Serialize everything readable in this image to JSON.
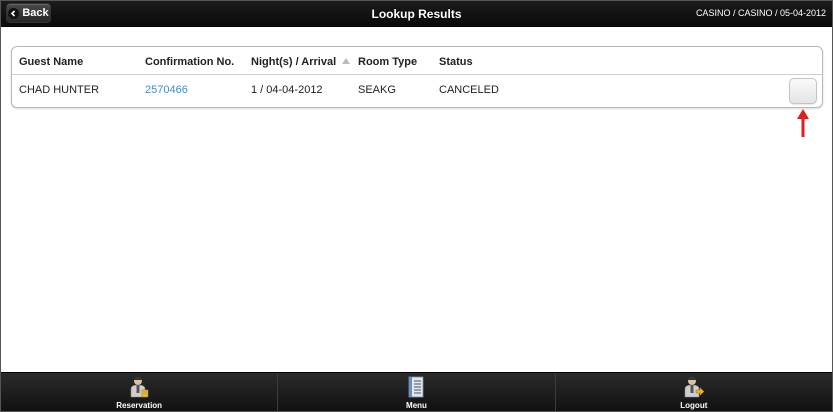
{
  "header": {
    "back_label": "Back",
    "title": "Lookup Results",
    "context": "CASINO / CASINO / 05-04-2012"
  },
  "table": {
    "columns": [
      "Guest Name",
      "Confirmation No.",
      "Night(s) / Arrival",
      "Room Type",
      "Status"
    ],
    "rows": [
      {
        "guest_name": "CHAD HUNTER",
        "confirmation_no": "2570466",
        "nights_arrival": "1 / 04-04-2012",
        "room_type": "SEAKG",
        "status": "CANCELED"
      }
    ]
  },
  "footer": {
    "items": [
      {
        "label": "Reservation",
        "icon": "reservation-icon"
      },
      {
        "label": "Menu",
        "icon": "menu-icon"
      },
      {
        "label": "Logout",
        "icon": "logout-icon"
      }
    ]
  },
  "colors": {
    "header_bg": "#111111",
    "link": "#3a8fd0",
    "annotation": "#e02020"
  }
}
